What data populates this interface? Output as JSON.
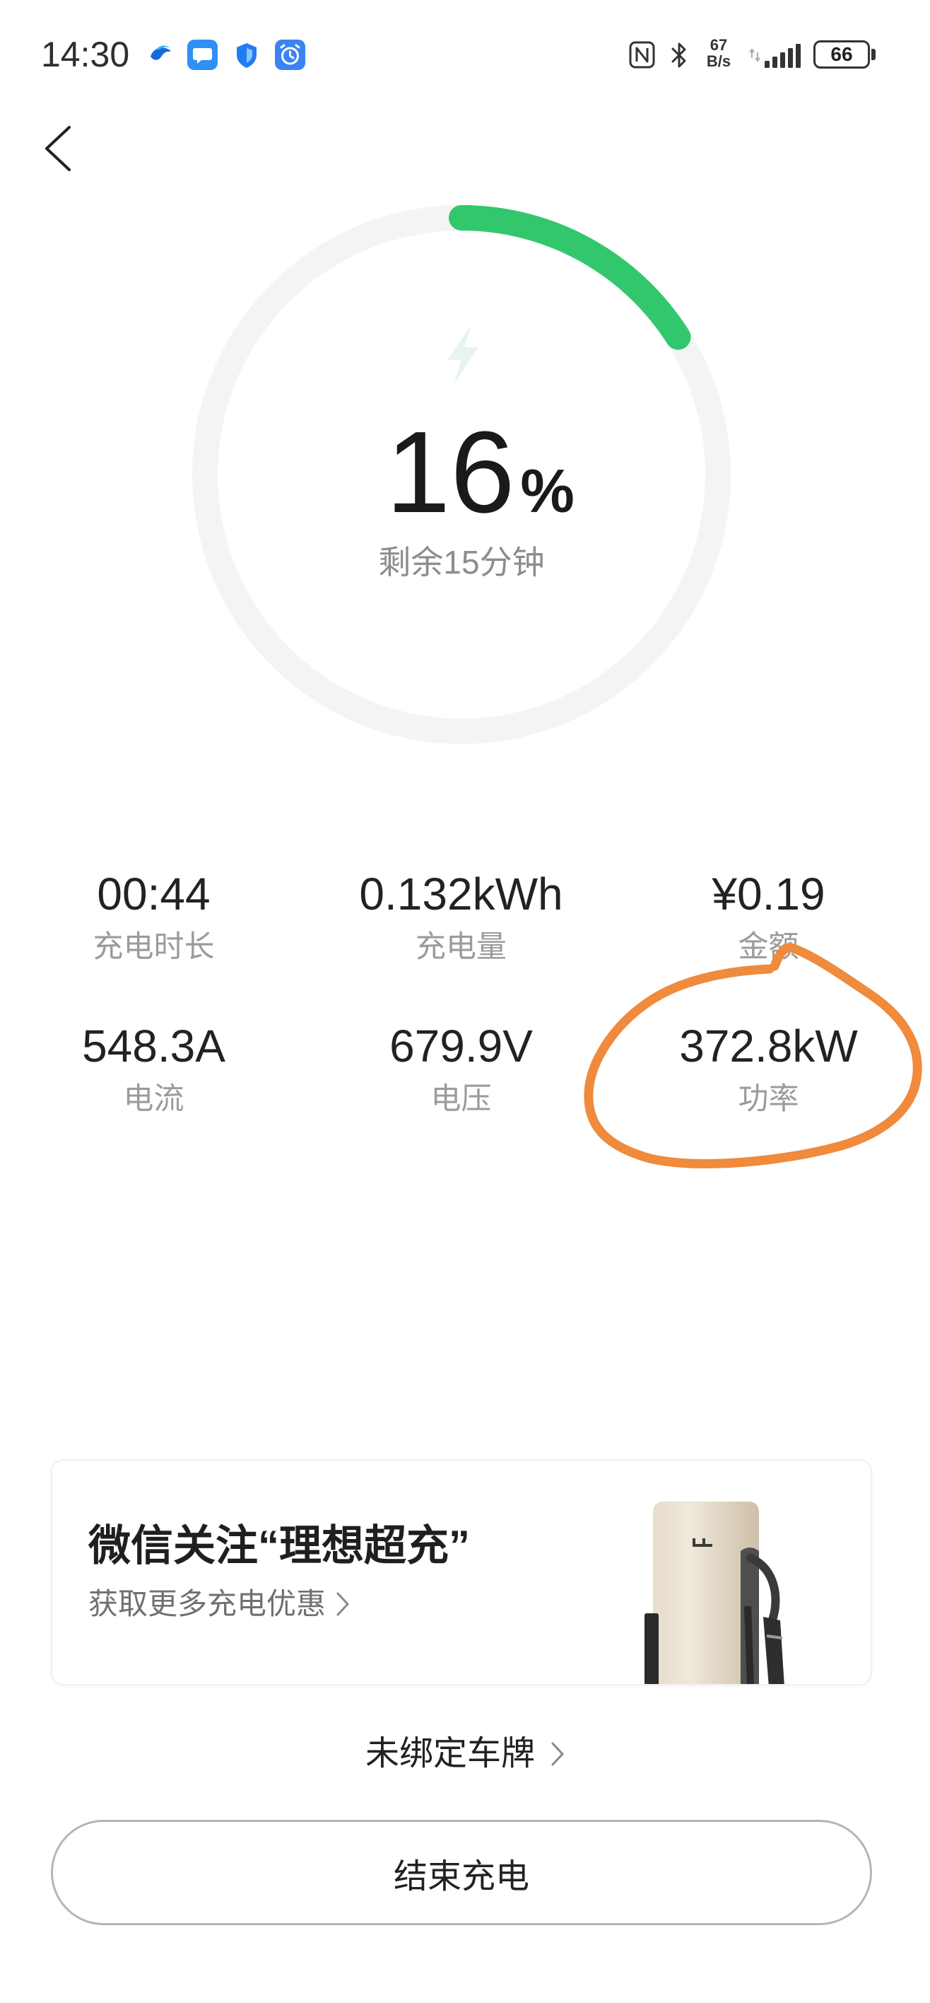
{
  "status_bar": {
    "time": "14:30",
    "icons": [
      "app-bird-icon",
      "message-icon",
      "shield-icon",
      "alarm-clock-icon",
      "nfc-icon",
      "bluetooth-icon",
      "signal-icon",
      "battery-icon"
    ],
    "net_speed": {
      "value": "67",
      "unit": "B/s"
    },
    "battery": "66"
  },
  "header": {
    "back_icon": "chevron-left-icon"
  },
  "charging": {
    "percent": "16",
    "percent_sign": "%",
    "remaining": "剩余15分钟",
    "progress_color": "#33c76d",
    "track_color": "#f4f4f4",
    "center_icon": "lightning-icon"
  },
  "stats": [
    {
      "value": "00:44",
      "label": "充电时长"
    },
    {
      "value": "0.132kWh",
      "label": "充电量"
    },
    {
      "value": "¥0.19",
      "label": "金额"
    },
    {
      "value": "548.3A",
      "label": "电流"
    },
    {
      "value": "679.9V",
      "label": "电压"
    },
    {
      "value": "372.8kW",
      "label": "功率"
    }
  ],
  "annotation": {
    "color": "#f08a3c"
  },
  "promo_card": {
    "title": "微信关注“理想超充”",
    "subtitle": "获取更多充电优惠",
    "chevron_icon": "chevron-right-icon",
    "image": "charger-image"
  },
  "plate": {
    "label": "未绑定车牌",
    "chevron_icon": "chevron-right-icon"
  },
  "end_button": {
    "label": "结束充电"
  }
}
